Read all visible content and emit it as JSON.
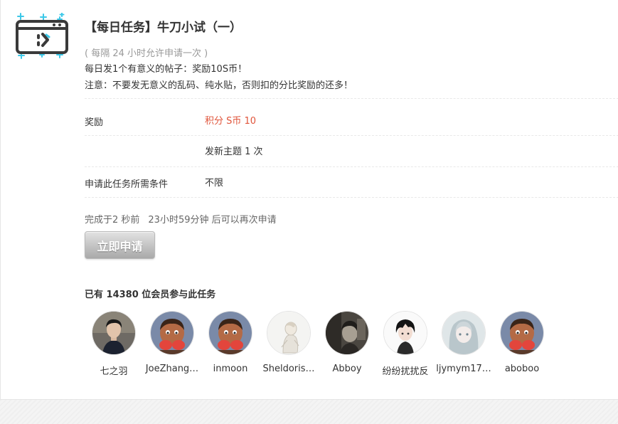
{
  "task": {
    "title": "【每日任务】牛刀小试（一）",
    "interval_note": "( 每隔 24 小时允许申请一次 )",
    "description_line1": "每日发1个有意义的帖子：奖励10S币！",
    "description_line2": "注意：不要发无意义的乱码、纯水贴，否则扣的分比奖励的还多！"
  },
  "details": {
    "reward_label": "奖励",
    "reward_value": "积分 S币 10",
    "requirement_value": "发新主题 1 次",
    "condition_label": "申请此任务所需条件",
    "condition_value": "不限"
  },
  "status": {
    "completed_text": "完成于2 秒前",
    "retry_text": "23小时59分钟 后可以再次申请"
  },
  "apply_button_label": "立即申请",
  "members": {
    "count_text": "已有 14380 位会员参与此任务",
    "list": [
      {
        "name": "七之羽",
        "avatar": "dark-hair-boy-avatar"
      },
      {
        "name": "JoeZhang…",
        "avatar": "cartoon-boy-avatar"
      },
      {
        "name": "inmoon",
        "avatar": "cartoon-boy-avatar"
      },
      {
        "name": "Sheldoris…",
        "avatar": "sketch-figure-avatar"
      },
      {
        "name": "Abboy",
        "avatar": "vintage-photo-avatar"
      },
      {
        "name": "纷纷扰扰反",
        "avatar": "anime-boy-avatar"
      },
      {
        "name": "ljymym17…",
        "avatar": "silver-hair-girl-avatar"
      },
      {
        "name": "aboboo",
        "avatar": "cartoon-boy-avatar"
      }
    ]
  },
  "colors": {
    "reward": "#e0543a",
    "muted": "#999999",
    "icon_accent": "#3cc8e8",
    "icon_stroke": "#3a3a3a"
  }
}
